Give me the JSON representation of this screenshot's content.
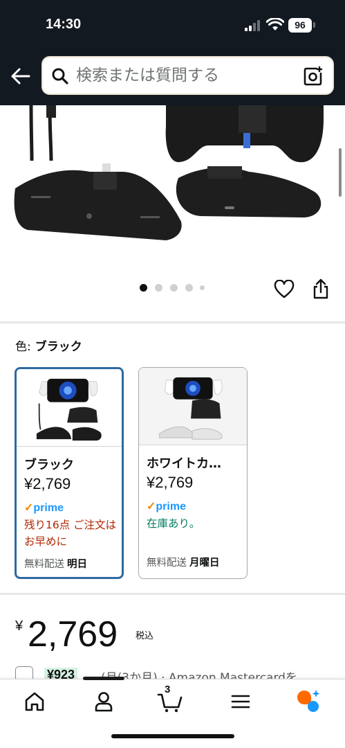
{
  "status_bar": {
    "time": "14:30",
    "battery": "96"
  },
  "search": {
    "placeholder": "検索または質問する"
  },
  "gallery": {
    "dots_count": 5,
    "active_dot": 0
  },
  "color": {
    "label": "色:",
    "value": "ブラック"
  },
  "swatches": [
    {
      "name": "ブラック",
      "price": "¥2,769",
      "prime": "prime",
      "stock": "残り16点 ご注文はお早めに",
      "stock_color": "#b12704",
      "ship_label": "無料配送",
      "ship_day": "明日",
      "selected": true
    },
    {
      "name": "ホワイトカ…",
      "price": "¥2,769",
      "prime": "prime",
      "stock": "在庫あり。",
      "stock_color": "#067d62",
      "ship_label": "無料配送",
      "ship_day": "月曜日",
      "selected": false
    }
  ],
  "price": {
    "currency": "¥",
    "amount": "2,769",
    "tax": "税込"
  },
  "promo": {
    "badge": "¥923",
    "text": "(月(3か月) · Amazon Mastercardを"
  },
  "tabbar": {
    "cart_count": "3"
  },
  "colors": {
    "header_bg": "#131921",
    "selected_border": "#2d6aa1",
    "prime_blue": "#1a98ff"
  }
}
